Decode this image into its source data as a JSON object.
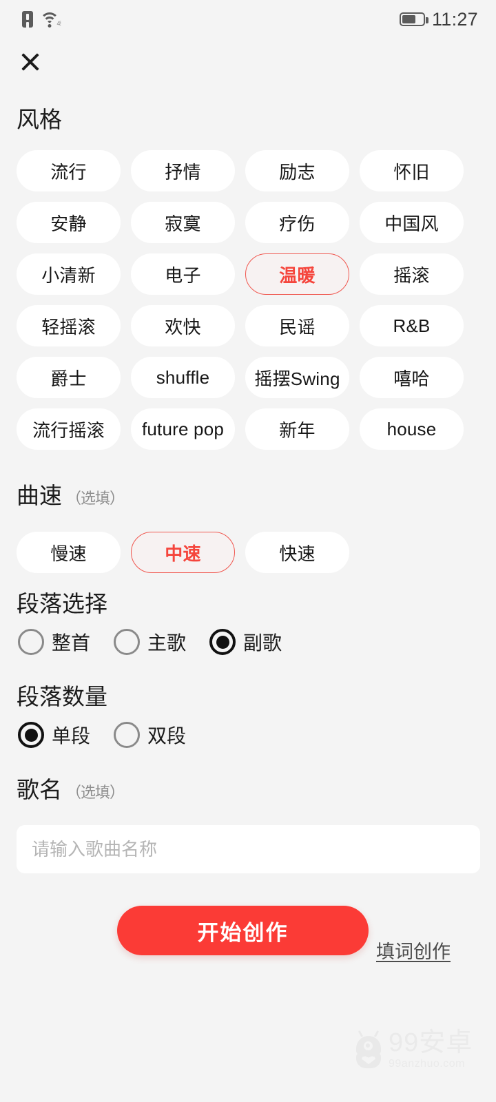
{
  "status_bar": {
    "time": "11:27",
    "icons": [
      "document-alert-icon",
      "wifi-icon",
      "battery-icon"
    ],
    "wifi_badge": "4⁞",
    "battery_level": 58
  },
  "header": {
    "close_icon": "close-icon"
  },
  "colors": {
    "page_background": "#f4f4f4",
    "chip_background": "#ffffff",
    "accent_red": "#fb3b36",
    "selected_border": "#f0574f",
    "selected_text": "#f5453c",
    "text_primary": "#1c1c1c",
    "text_muted": "#8e8e8e",
    "placeholder": "#b5b5b5"
  },
  "style_section": {
    "title": "风格",
    "chips": [
      {
        "label": "流行",
        "selected": false
      },
      {
        "label": "抒情",
        "selected": false
      },
      {
        "label": "励志",
        "selected": false
      },
      {
        "label": "怀旧",
        "selected": false
      },
      {
        "label": "安静",
        "selected": false
      },
      {
        "label": "寂寞",
        "selected": false
      },
      {
        "label": "疗伤",
        "selected": false
      },
      {
        "label": "中国风",
        "selected": false
      },
      {
        "label": "小清新",
        "selected": false
      },
      {
        "label": "电子",
        "selected": false
      },
      {
        "label": "温暖",
        "selected": true
      },
      {
        "label": "摇滚",
        "selected": false
      },
      {
        "label": "轻摇滚",
        "selected": false
      },
      {
        "label": "欢快",
        "selected": false
      },
      {
        "label": "民谣",
        "selected": false
      },
      {
        "label": "R&B",
        "selected": false
      },
      {
        "label": "爵士",
        "selected": false
      },
      {
        "label": "shuffle",
        "selected": false
      },
      {
        "label": "摇摆Swing",
        "selected": false
      },
      {
        "label": "嘻哈",
        "selected": false
      },
      {
        "label": "流行摇滚",
        "selected": false
      },
      {
        "label": "future pop",
        "selected": false
      },
      {
        "label": "新年",
        "selected": false
      },
      {
        "label": "house",
        "selected": false
      }
    ]
  },
  "tempo_section": {
    "title": "曲速",
    "optional_label": "（选填）",
    "chips": [
      {
        "label": "慢速",
        "selected": false
      },
      {
        "label": "中速",
        "selected": true
      },
      {
        "label": "快速",
        "selected": false
      }
    ]
  },
  "part_section": {
    "title": "段落选择",
    "options": [
      {
        "label": "整首",
        "selected": false
      },
      {
        "label": "主歌",
        "selected": false
      },
      {
        "label": "副歌",
        "selected": true
      }
    ]
  },
  "count_section": {
    "title": "段落数量",
    "options": [
      {
        "label": "单段",
        "selected": true
      },
      {
        "label": "双段",
        "selected": false
      }
    ]
  },
  "name_section": {
    "title": "歌名",
    "optional_label": "（选填）",
    "input_value": "",
    "input_placeholder": "请输入歌曲名称"
  },
  "actions": {
    "primary_label": "开始创作",
    "secondary_label": "填词创作"
  },
  "watermark": {
    "main": "99安卓",
    "sub": "99anzhuo.com"
  }
}
